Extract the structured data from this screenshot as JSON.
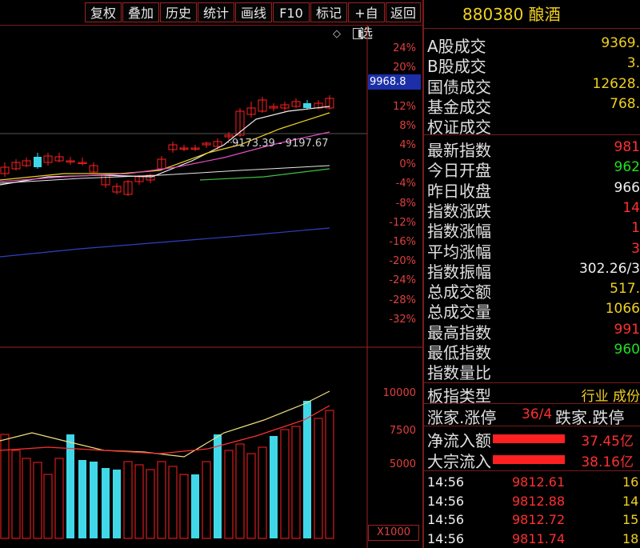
{
  "toolbar": {
    "buttons": [
      "复权",
      "叠加",
      "历史",
      "统计",
      "画线",
      "F10",
      "标记",
      "+自选",
      "返回"
    ]
  },
  "chart": {
    "pct_axis": [
      "24%",
      "20%",
      "16%",
      "12%",
      "8%",
      "4%",
      "0%",
      "-4%",
      "-8%",
      "-12%",
      "-16%",
      "-20%",
      "-24%",
      "-28%",
      "-32%"
    ],
    "current_price": "9968.8",
    "range_label": "9173.39 - 9197.67",
    "volume_axis": [
      "10000",
      "7500",
      "5000"
    ],
    "volume_unit": "X1000"
  },
  "panel": {
    "title": "880380 酿酒",
    "stats": [
      {
        "label": "A股成交",
        "value": "9369.",
        "color": "y"
      },
      {
        "label": "B股成交",
        "value": "3.",
        "color": "y"
      },
      {
        "label": "国债成交",
        "value": "12628.",
        "color": "y"
      },
      {
        "label": "基金成交",
        "value": "768.",
        "color": "y"
      },
      {
        "label": "权证成交",
        "value": "",
        "color": "y"
      }
    ],
    "index": [
      {
        "label": "最新指数",
        "value": "981",
        "color": "r"
      },
      {
        "label": "今日开盘",
        "value": "962",
        "color": "g"
      },
      {
        "label": "昨日收盘",
        "value": "966",
        "color": "w"
      },
      {
        "label": "指数涨跌",
        "value": "14",
        "color": "r"
      },
      {
        "label": "指数涨幅",
        "value": "1",
        "color": "r"
      },
      {
        "label": "平均涨幅",
        "value": "3",
        "color": "r"
      },
      {
        "label": "指数振幅",
        "value": "302.26/3",
        "color": "w"
      },
      {
        "label": "总成交额",
        "value": "517.",
        "color": "y"
      },
      {
        "label": "总成交量",
        "value": "1066",
        "color": "y"
      },
      {
        "label": "最高指数",
        "value": "991",
        "color": "r"
      },
      {
        "label": "最低指数",
        "value": "960",
        "color": "g"
      },
      {
        "label": "指数量比",
        "value": "",
        "color": "w"
      }
    ],
    "board_type": {
      "label": "板指类型",
      "value": "行业 成份"
    },
    "limit": {
      "label": "涨家.涨停",
      "value": "36/4",
      "label2": "跌家.跌停"
    },
    "flows": [
      {
        "label": "净流入额",
        "value": "37.45亿"
      },
      {
        "label": "大宗流入",
        "value": "38.16亿"
      }
    ],
    "ticks": [
      {
        "time": "14:56",
        "price": "9812.61",
        "vol": "16"
      },
      {
        "time": "14:56",
        "price": "9812.88",
        "vol": "14"
      },
      {
        "time": "14:56",
        "price": "9812.72",
        "vol": "15"
      },
      {
        "time": "14:56",
        "price": "9811.74",
        "vol": "18"
      }
    ]
  }
}
